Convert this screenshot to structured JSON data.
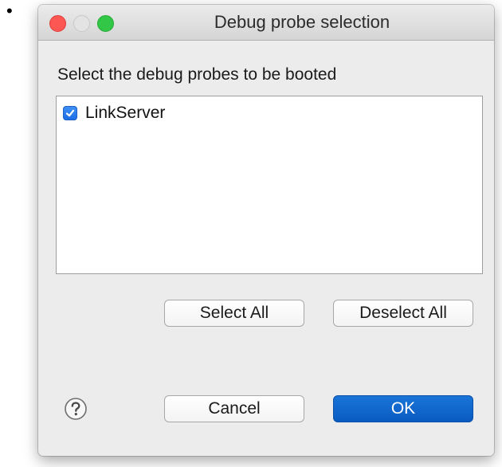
{
  "window": {
    "title": "Debug probe selection"
  },
  "dialog": {
    "prompt": "Select the debug probes to be booted",
    "probes": [
      {
        "label": "LinkServer",
        "checked": true
      }
    ]
  },
  "buttons": {
    "select_all": "Select All",
    "deselect_all": "Deselect All",
    "cancel": "Cancel",
    "ok": "OK"
  },
  "icons": {
    "bullet": "•",
    "help": "question-circle-icon",
    "check": "checkmark-icon"
  },
  "colors": {
    "accent": "#0a5bc2",
    "close": "#fc5753",
    "zoom": "#33c748"
  }
}
